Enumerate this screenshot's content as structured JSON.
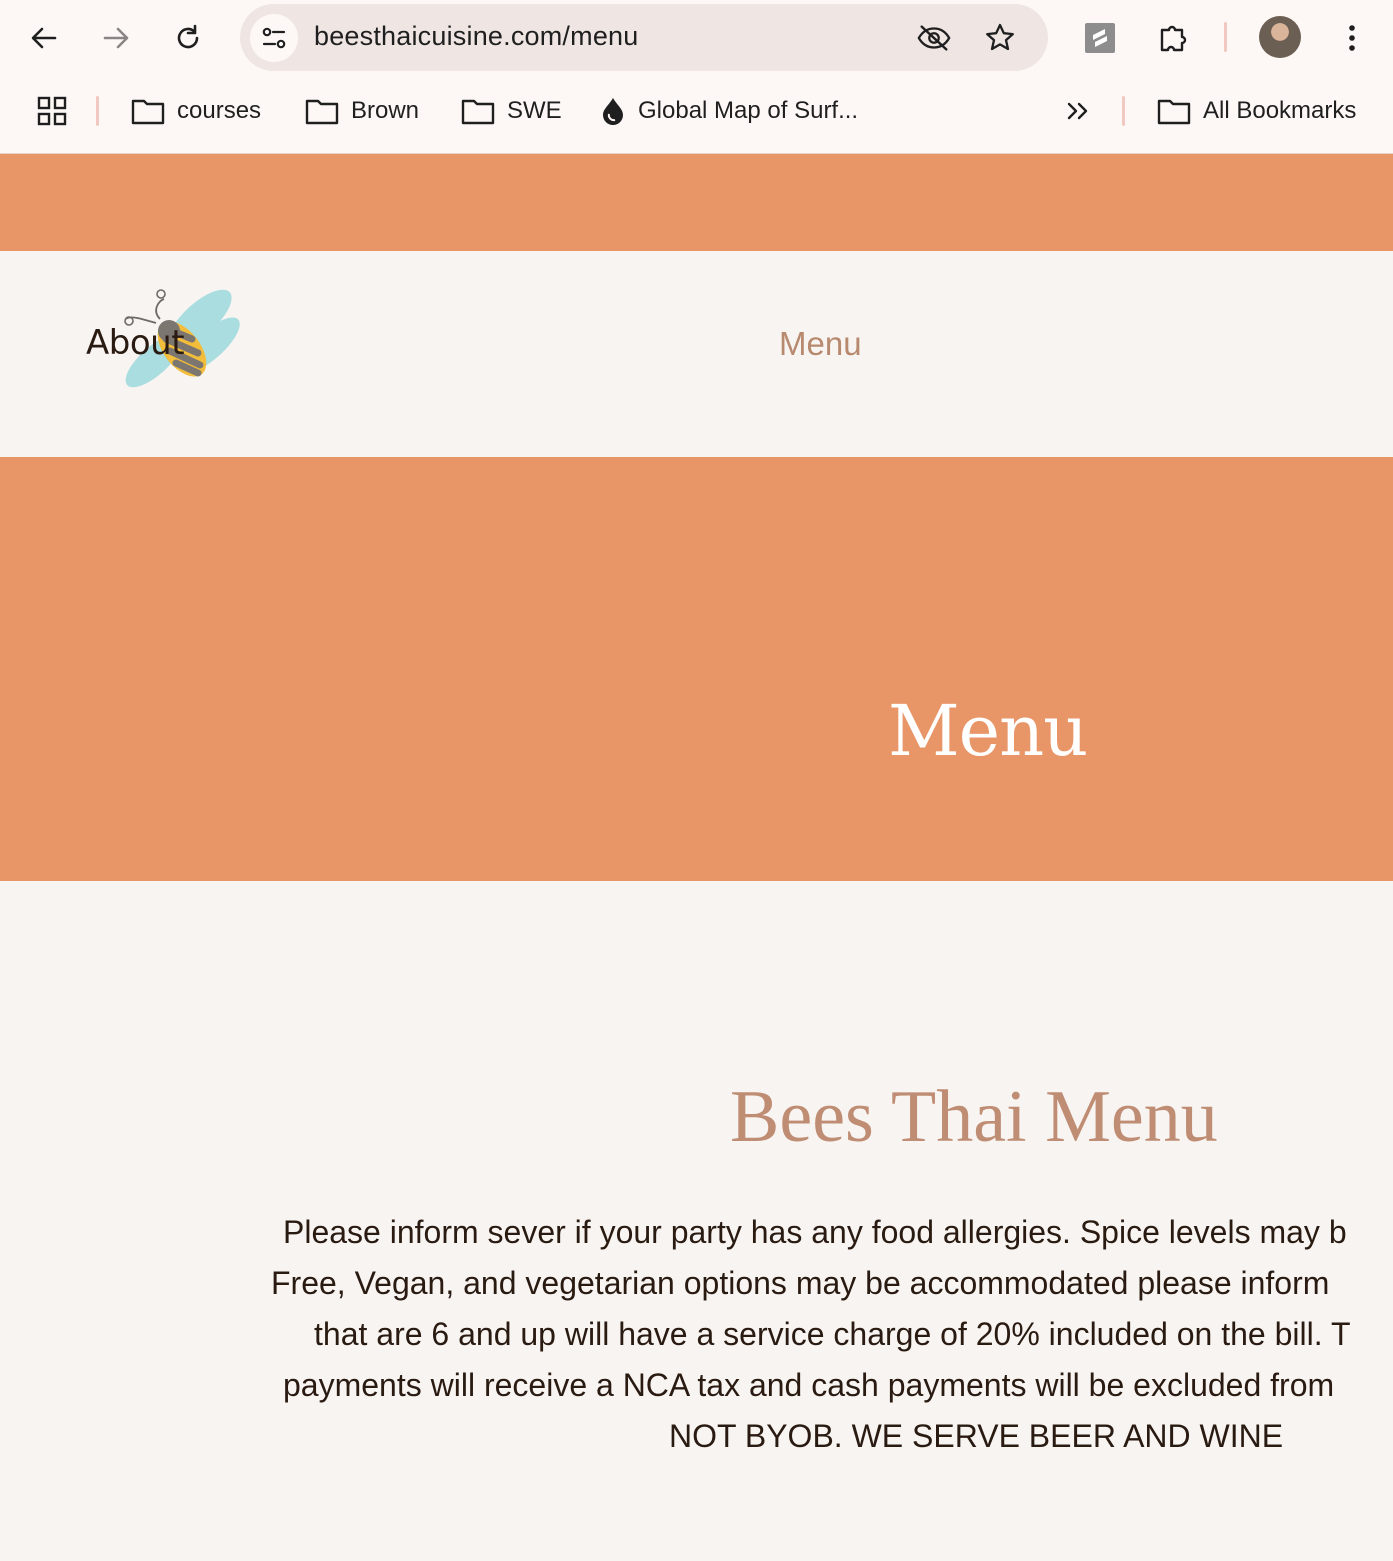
{
  "browser": {
    "url": "beesthaicuisine.com/menu",
    "bookmarks": [
      {
        "label": "courses",
        "icon": "folder-icon"
      },
      {
        "label": "Brown",
        "icon": "folder-icon"
      },
      {
        "label": "SWE",
        "icon": "folder-icon"
      },
      {
        "label": "Global Map of Surf...",
        "icon": "drop-icon"
      }
    ],
    "all_bookmarks_label": "All Bookmarks"
  },
  "site": {
    "logo_text": "About",
    "nav_menu": "Menu",
    "hero_title": "Menu",
    "section_title": "Bees Thai Menu",
    "notice_lines": [
      "Please inform sever if your party has any food allergies. Spice levels may b",
      "Free, Vegan, and vegetarian options may be accommodated please inform",
      "that are 6 and up will have a service charge of 20% included on the bill. T",
      "payments will receive a NCA tax and cash payments will be excluded from",
      "NOT BYOB. WE SERVE BEER AND WINE"
    ]
  },
  "colors": {
    "accent": "#e89668",
    "title": "#bf8d73",
    "nav": "#b78a6f",
    "text": "#2a1b12",
    "background": "#f8f4f1"
  }
}
